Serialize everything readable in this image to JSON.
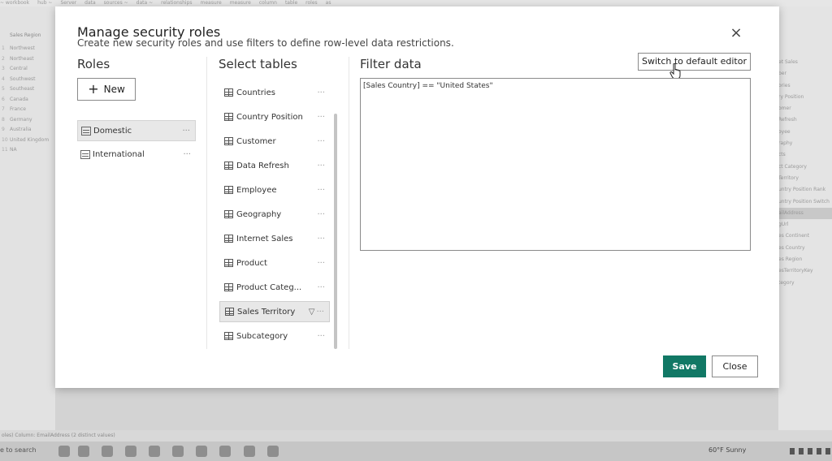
{
  "background": {
    "ribbon_items": [
      "~ workbook",
      "hub ~",
      "Server",
      "data",
      "sources ~",
      "data ~",
      "relationships",
      "measure",
      "measure",
      "column",
      "table",
      "roles",
      "as"
    ],
    "left_panel": {
      "header": "Sales Region",
      "rows": [
        {
          "n": "1",
          "label": "Northwest"
        },
        {
          "n": "2",
          "label": "Northeast"
        },
        {
          "n": "3",
          "label": "Central"
        },
        {
          "n": "4",
          "label": "Southwest"
        },
        {
          "n": "5",
          "label": "Southeast"
        },
        {
          "n": "6",
          "label": "Canada"
        },
        {
          "n": "7",
          "label": "France"
        },
        {
          "n": "8",
          "label": "Germany"
        },
        {
          "n": "9",
          "label": "Australia"
        },
        {
          "n": "10",
          "label": "United Kingdom"
        },
        {
          "n": "11",
          "label": "NA"
        }
      ]
    },
    "right_panel_items": [
      "et Sales",
      "ber",
      "ories",
      "ry Position",
      "omer",
      "Refresh",
      "oyee",
      "raphy",
      "cts",
      "ct Category",
      "Territory",
      "untry Position Rank",
      "untry Position Switch",
      "ailAddress",
      "gUrl",
      "es Continent",
      "es Country",
      "es Region",
      "esTerritoryKey",
      "tegory"
    ],
    "status_text": "oles) Column: EmailAddress (2 distinct values)",
    "taskbar_search": "e to search",
    "weather": "60°F  Sunny"
  },
  "dialog": {
    "title": "Manage security roles",
    "subtitle": "Create new security roles and use filters to define row-level data restrictions.",
    "roles_heading": "Roles",
    "new_button": "New",
    "roles": [
      {
        "label": "Domestic",
        "selected": true
      },
      {
        "label": "International",
        "selected": false
      }
    ],
    "tables_heading": "Select tables",
    "tables": [
      {
        "label": "Countries"
      },
      {
        "label": "Country Position"
      },
      {
        "label": "Customer"
      },
      {
        "label": "Data Refresh"
      },
      {
        "label": "Employee"
      },
      {
        "label": "Geography"
      },
      {
        "label": "Internet Sales"
      },
      {
        "label": "Product"
      },
      {
        "label": "Product Categ..."
      },
      {
        "label": "Sales Territory",
        "selected": true,
        "filtered": true
      },
      {
        "label": "Subcategory"
      }
    ],
    "filter_heading": "Filter data",
    "switch_button": "Switch to default editor",
    "filter_expression": "[Sales Country] == \"United States\"",
    "save_button": "Save",
    "close_button": "Close",
    "more_glyph": "···",
    "close_glyph": "×",
    "filter_glyph": "▽",
    "accent_color": "#117865"
  }
}
